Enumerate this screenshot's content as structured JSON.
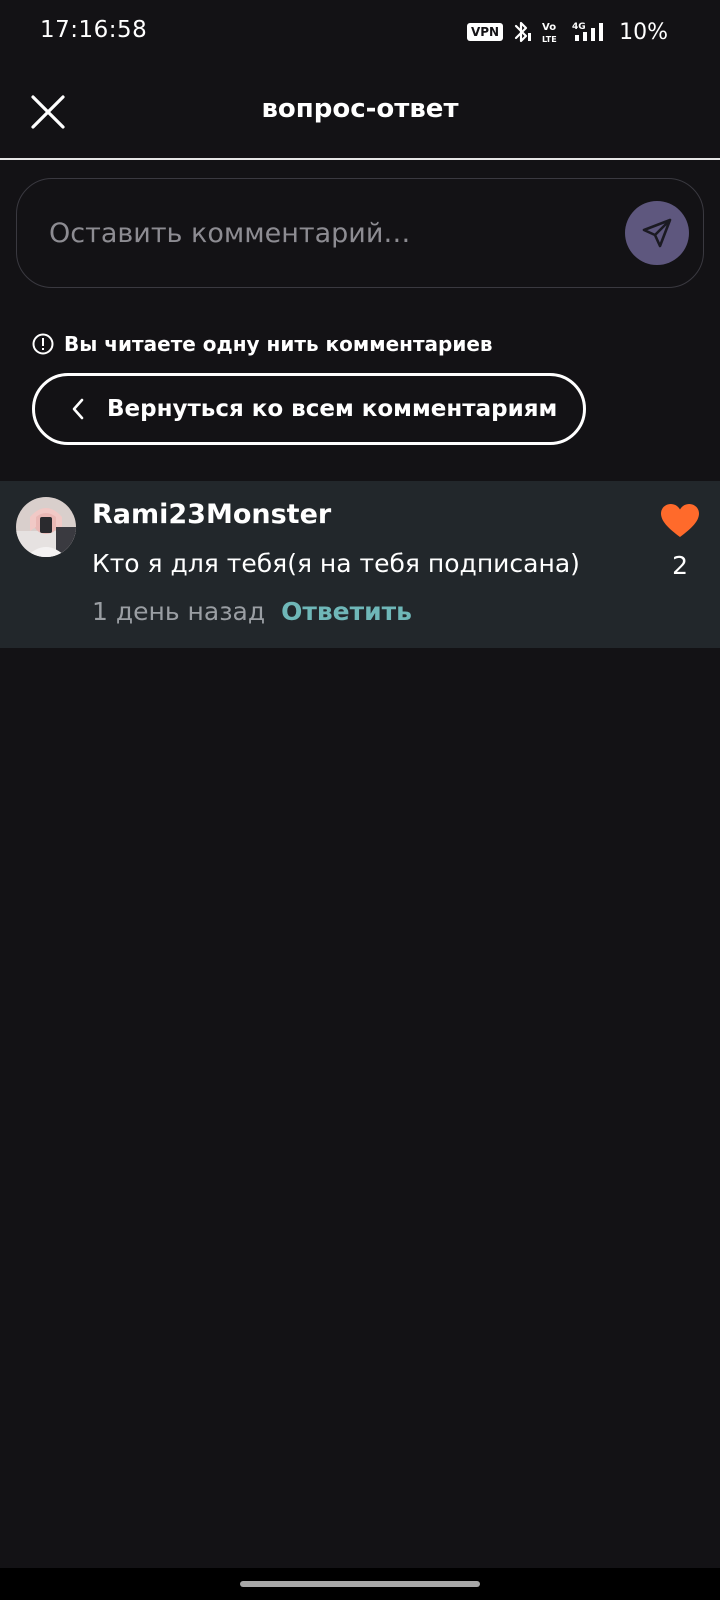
{
  "status_bar": {
    "time": "17:16:58",
    "vpn_label": "VPN",
    "battery": "10%",
    "icons": [
      "vpn-icon",
      "bluetooth-icon",
      "volte-icon",
      "signal-4g-icon"
    ]
  },
  "header": {
    "title": "вопрос-ответ",
    "close_icon": "close-icon"
  },
  "comment_input": {
    "placeholder": "Оставить комментарий…",
    "value": "",
    "send_icon": "send-icon"
  },
  "thread": {
    "notice": "Вы читаете одну нить комментариев",
    "notice_icon": "info-icon",
    "back_button_label": "Вернуться ко всем комментариям",
    "back_icon": "chevron-left-icon"
  },
  "comments": [
    {
      "username": "Rami23Monster",
      "text": "Кто я для тебя(я на тебя подписана)",
      "time": "1 день назад",
      "reply_label": "Ответить",
      "likes": "2",
      "liked": true
    }
  ],
  "colors": {
    "background": "#131215",
    "comment_row": "#22272b",
    "send_button": "#5e577e",
    "reply_link": "#6fb7b8",
    "like_heart": "#ff6a2b",
    "muted_text": "#9a9ea3"
  }
}
